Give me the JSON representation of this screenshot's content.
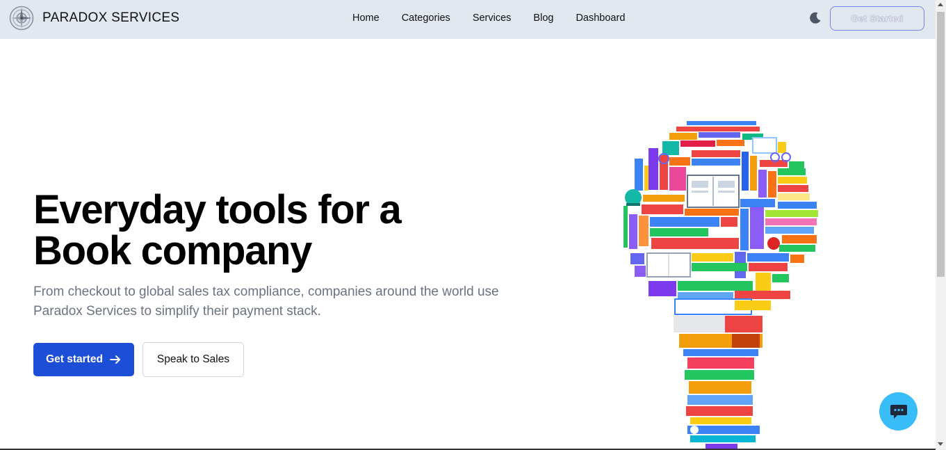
{
  "brand": {
    "name": "PARADOX SERVICES",
    "logo_icon": "compass-logo-icon"
  },
  "nav": {
    "links": [
      "Home",
      "Categories",
      "Services",
      "Blog",
      "Dashboard"
    ],
    "theme_icon": "moon-icon",
    "cta_label": "Get Started"
  },
  "hero": {
    "title_line1": "Everyday tools for a",
    "title_line2": "Book company",
    "subtitle": "From checkout to global sales tax compliance, companies around the world use Paradox Services to simplify their payment stack.",
    "primary_label": "Get started",
    "primary_icon": "arrow-right-icon",
    "secondary_label": "Speak to Sales",
    "illustration": "lightbulb-of-books-illustration"
  },
  "chat": {
    "icon": "chat-bubble-icon"
  },
  "colors": {
    "navbar_bg": "#e2e8f0",
    "primary": "#1d4ed8",
    "chat": "#38bdf8",
    "subtitle": "#6b7280"
  }
}
